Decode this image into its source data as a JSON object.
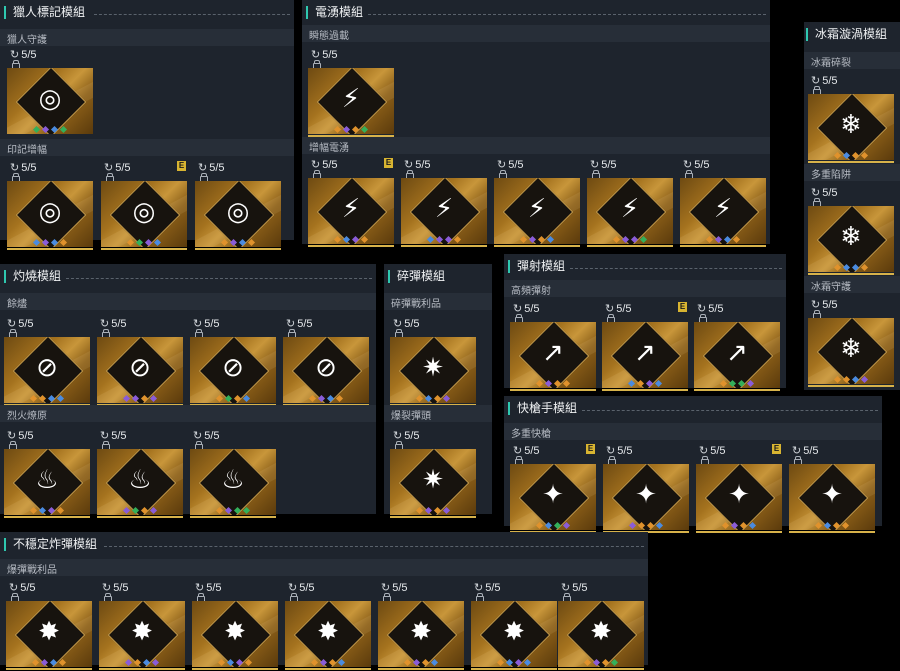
{
  "counter_text": "5/5",
  "e_badge": "E",
  "colors": {
    "orange": "#e0922c",
    "purple": "#8a5cd8",
    "blue": "#4a8be0",
    "green": "#33b05a",
    "underline": "#d7b24a"
  },
  "panels": {
    "hunter": {
      "title": "獵人標記模組",
      "sub1": "獵人守護",
      "sub2": "印記增幅"
    },
    "electric": {
      "title": "電湧模組",
      "sub1": "瞬態過載",
      "sub2": "增幅電湧"
    },
    "frost": {
      "title": "冰霜漩渦模組",
      "sub1": "冰霜碎裂",
      "sub2": "多重陷阱",
      "sub3": "冰霜守護"
    },
    "burn": {
      "title": "灼燒模組",
      "sub1": "餘燼",
      "sub2": "烈火燎原"
    },
    "shatter": {
      "title": "碎彈模組",
      "sub1": "碎彈戰利品",
      "sub2": "爆裂彈頭"
    },
    "bounce": {
      "title": "彈射模組",
      "sub1": "高頻彈射"
    },
    "quickdraw": {
      "title": "快槍手模組",
      "sub1": "多重快槍"
    },
    "unstable": {
      "title": "不穩定炸彈模組",
      "sub1": "爆彈戰利品"
    }
  }
}
